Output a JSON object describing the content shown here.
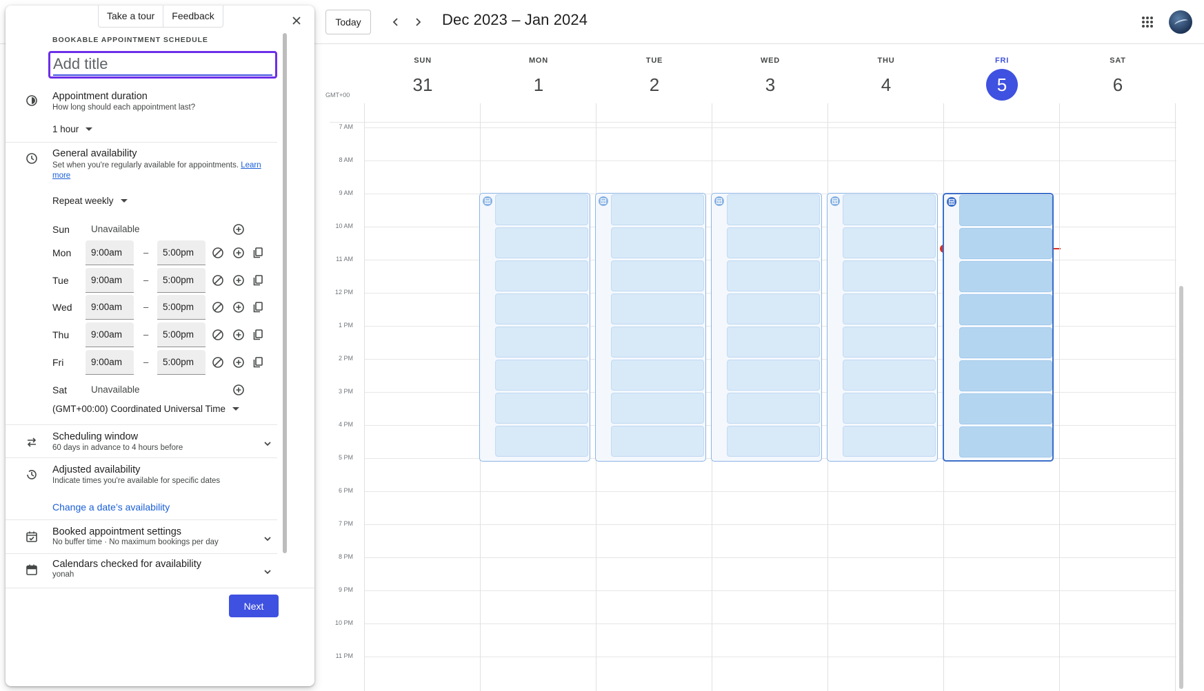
{
  "calendar": {
    "today_label": "Today",
    "range_title": "Dec 2023 – Jan 2024",
    "timezone": "GMT+00",
    "days": [
      {
        "name": "SUN",
        "num": "31"
      },
      {
        "name": "MON",
        "num": "1"
      },
      {
        "name": "TUE",
        "num": "2"
      },
      {
        "name": "WED",
        "num": "3"
      },
      {
        "name": "THU",
        "num": "4"
      },
      {
        "name": "FRI",
        "num": "5"
      },
      {
        "name": "SAT",
        "num": "6"
      }
    ],
    "hours": [
      "7 AM",
      "8 AM",
      "9 AM",
      "10 AM",
      "11 AM",
      "12 PM",
      "1 PM",
      "2 PM",
      "3 PM",
      "4 PM",
      "5 PM",
      "6 PM",
      "7 PM",
      "8 PM",
      "9 PM",
      "10 PM",
      "11 PM"
    ],
    "availability_days": [
      "MON",
      "TUE",
      "WED",
      "THU",
      "FRI"
    ],
    "availability_slots_per_day": 8,
    "selected_day": "FRI",
    "colors": {
      "accent": "#3f51e0",
      "now_line": "#d93025",
      "slot": "#d8e9f8",
      "slot_selected": "#b4d5f0"
    }
  },
  "panel": {
    "tour_label": "Take a tour",
    "feedback_label": "Feedback",
    "schedule_type": "BOOKABLE APPOINTMENT SCHEDULE",
    "title_placeholder": "Add title",
    "duration": {
      "title": "Appointment duration",
      "sub": "How long should each appointment last?",
      "value": "1 hour"
    },
    "general": {
      "title": "General availability",
      "sub": "Set when you're regularly available for appointments.",
      "link": "Learn more",
      "repeat": "Repeat weekly"
    },
    "schedule": [
      {
        "day": "Sun",
        "unavailable": "Unavailable"
      },
      {
        "day": "Mon",
        "start": "9:00am",
        "end": "5:00pm"
      },
      {
        "day": "Tue",
        "start": "9:00am",
        "end": "5:00pm"
      },
      {
        "day": "Wed",
        "start": "9:00am",
        "end": "5:00pm"
      },
      {
        "day": "Thu",
        "start": "9:00am",
        "end": "5:00pm"
      },
      {
        "day": "Fri",
        "start": "9:00am",
        "end": "5:00pm"
      },
      {
        "day": "Sat",
        "unavailable": "Unavailable"
      }
    ],
    "dash": "–",
    "timezone": "(GMT+00:00) Coordinated Universal Time",
    "scheduling_window": {
      "title": "Scheduling window",
      "sub": "60 days in advance to 4 hours before"
    },
    "adjusted": {
      "title": "Adjusted availability",
      "sub": "Indicate times you're available for specific dates",
      "link": "Change a date’s availability"
    },
    "booked": {
      "title": "Booked appointment settings",
      "sub": "No buffer time · No maximum bookings per day"
    },
    "calendars": {
      "title": "Calendars checked for availability",
      "sub": "yonah"
    },
    "next_label": "Next"
  }
}
